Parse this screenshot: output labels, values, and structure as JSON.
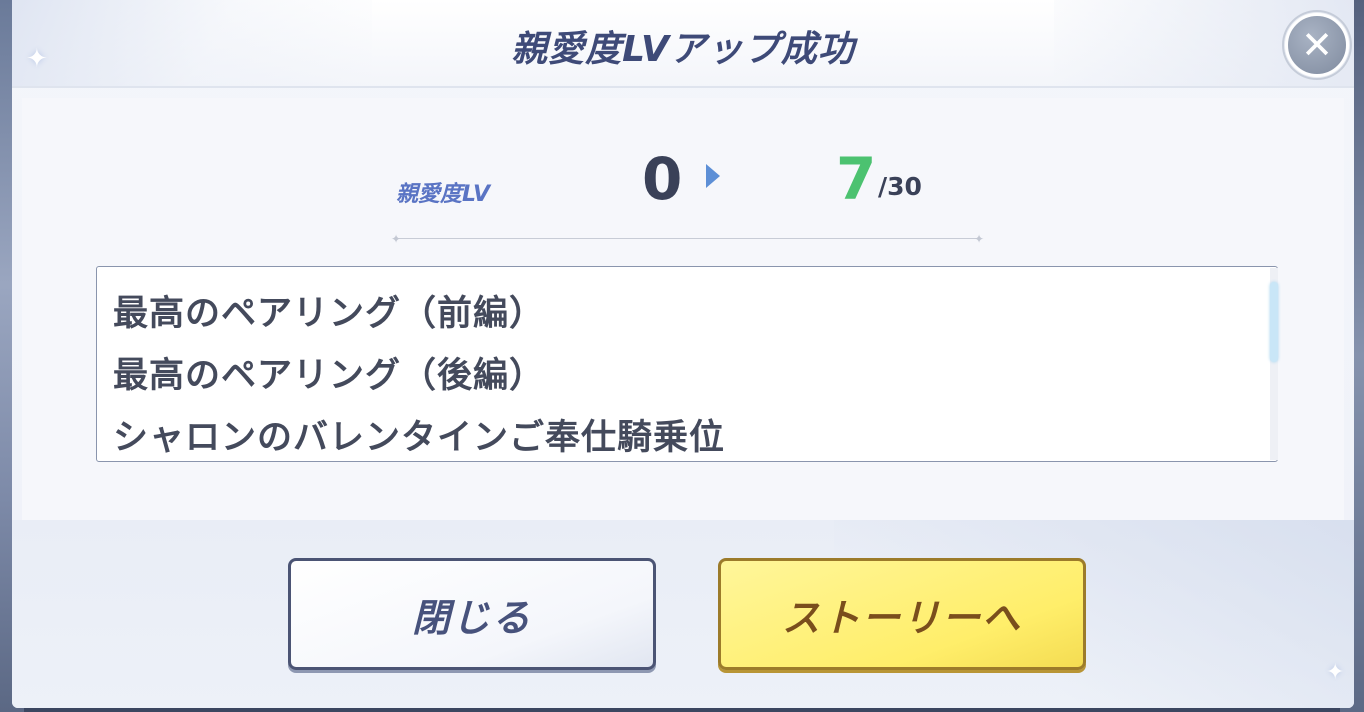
{
  "dialog": {
    "title": "親愛度LVアップ成功",
    "close_icon": "close-icon"
  },
  "affection": {
    "label": "親愛度LV",
    "old_level": "0",
    "new_level": "7",
    "max_level": "/30"
  },
  "stories": [
    "最高のペアリング（前編）",
    "最高のペアリング（後編）",
    "シャロンのバレンタインご奉仕騎乗位"
  ],
  "buttons": {
    "close_label": "閉じる",
    "story_label": "ストーリーへ"
  },
  "colors": {
    "title": "#3e4a78",
    "new_level": "#4cc270",
    "story_button": "#ffee6a"
  }
}
